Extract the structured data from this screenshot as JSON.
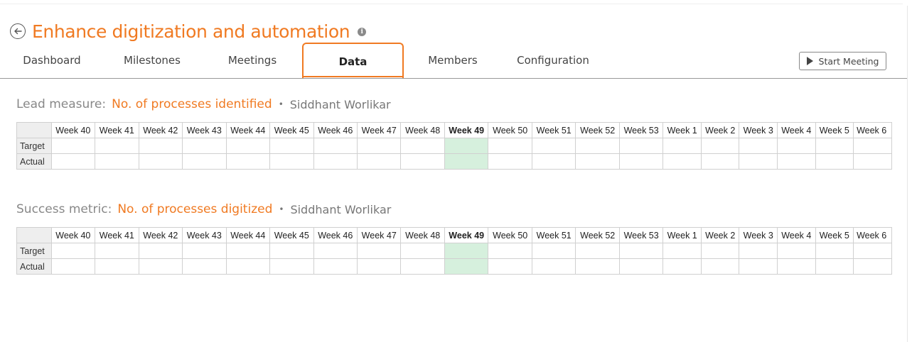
{
  "page": {
    "title": "Enhance digitization and automation",
    "info_icon_glyph": "i"
  },
  "tabs": [
    {
      "label": "Dashboard"
    },
    {
      "label": "Milestones"
    },
    {
      "label": "Meetings"
    },
    {
      "label": "Data"
    },
    {
      "label": "Members"
    },
    {
      "label": "Configuration"
    }
  ],
  "active_tab": "Data",
  "toolbar": {
    "start_meeting_label": "Start Meeting"
  },
  "weeks": [
    "Week 40",
    "Week 41",
    "Week 42",
    "Week 43",
    "Week 44",
    "Week 45",
    "Week 46",
    "Week 47",
    "Week 48",
    "Week 49",
    "Week 50",
    "Week 51",
    "Week 52",
    "Week 53",
    "Week 1",
    "Week 2",
    "Week 3",
    "Week 4",
    "Week 5",
    "Week 6"
  ],
  "current_week": "Week 49",
  "rows": [
    "Target",
    "Actual"
  ],
  "lead_measure": {
    "kind": "Lead measure:",
    "name": "No. of processes identified",
    "separator": "•",
    "owner": "Siddhant Worlikar"
  },
  "success_metric": {
    "kind": "Success metric:",
    "name": "No. of processes digitized",
    "separator": "•",
    "owner": "Siddhant Worlikar"
  },
  "colors": {
    "accent": "#f07a22",
    "current_week_fill": "#d6f0dd"
  }
}
